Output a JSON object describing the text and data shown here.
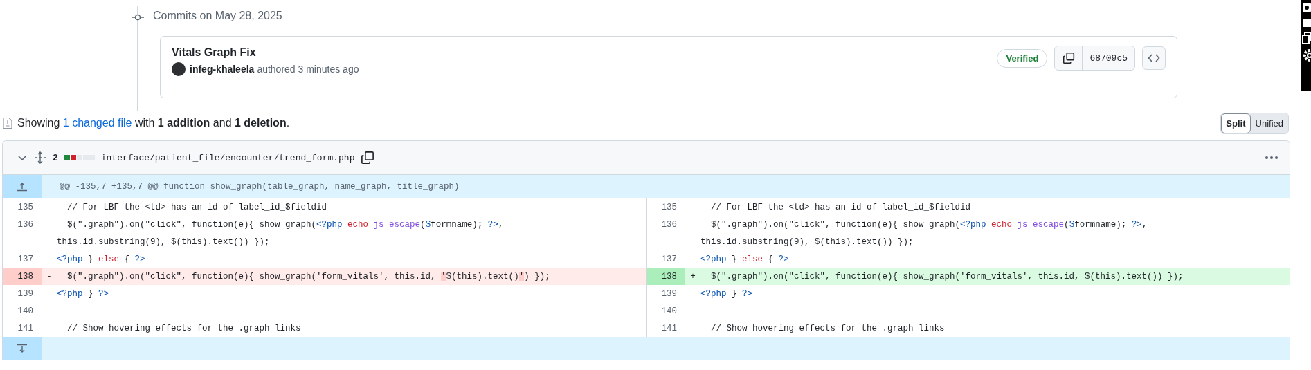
{
  "timeline": {
    "heading": "Commits on May 28, 2025"
  },
  "commit": {
    "title": "Vitals Graph Fix",
    "author": "infeg-khaleela",
    "meta": "authored 3 minutes ago",
    "badge": "Verified",
    "sha": "68709c5"
  },
  "summary": {
    "prefix": "Showing",
    "link": "1 changed file",
    "rest": "with **1 addition** and **1 deletion**."
  },
  "view_toggle": [
    {
      "label": "Split",
      "selected": true
    },
    {
      "label": "Unified",
      "selected": false
    }
  ],
  "file": {
    "count": "2",
    "blocks": [
      {
        "color": "#1f883d"
      },
      {
        "color": "#cf222e"
      },
      {
        "color": "#e6e9ed"
      },
      {
        "color": "#e6e9ed"
      },
      {
        "color": "#e6e9ed"
      }
    ],
    "path": "interface/patient_file/encounter/trend_form.php",
    "hunk_header": "@@ -135,7 +135,7 @@ function show_graph(table_graph, name_graph, title_graph)",
    "left": [
      {
        "num": "135",
        "kind": "context",
        "tokens": [
          {
            "t": "  // For LBF the <td> has an id of label_id_$fieldid",
            "kind": "plain"
          }
        ]
      },
      {
        "num": "136",
        "kind": "context",
        "tokens": [
          {
            "t": "  $(\".graph\").on(\"click\", function(e){ show_graph(",
            "kind": "plain"
          },
          {
            "t": "<?php",
            "kind": "tag"
          },
          {
            "t": " echo",
            "kind": "keyword"
          },
          {
            "t": " js_escape",
            "kind": "func"
          },
          {
            "t": "(",
            "kind": "plain"
          },
          {
            "t": "$",
            "kind": "tag"
          },
          {
            "t": "formname); ",
            "kind": "plain"
          },
          {
            "t": "?>",
            "kind": "tag"
          },
          {
            "t": ",",
            "kind": "plain"
          }
        ],
        "continued": "this.id.substring(9), $(this).text()) });"
      },
      {
        "num": "137",
        "kind": "context",
        "tokens": [
          {
            "t": "<?php",
            "kind": "tag"
          },
          {
            "t": " } ",
            "kind": "plain"
          },
          {
            "t": "else",
            "kind": "keyword"
          },
          {
            "t": " { ",
            "kind": "plain"
          },
          {
            "t": "?>",
            "kind": "tag"
          }
        ]
      },
      {
        "num": "138",
        "kind": "deletion",
        "marker": "-",
        "tokens": [
          {
            "t": "  $(\".graph\").on(\"click\", function(e){ show_graph('form_vitals', this.id, ",
            "kind": "plain"
          },
          {
            "t": "'",
            "kind": "changed"
          },
          {
            "t": "$(this).text()",
            "kind": "plain"
          },
          {
            "t": "'",
            "kind": "changed"
          },
          {
            "t": ") });",
            "kind": "plain"
          }
        ]
      },
      {
        "num": "139",
        "kind": "context",
        "tokens": [
          {
            "t": "<?php",
            "kind": "tag"
          },
          {
            "t": " } ",
            "kind": "plain"
          },
          {
            "t": "?>",
            "kind": "tag"
          }
        ]
      },
      {
        "num": "140",
        "kind": "context"
      },
      {
        "num": "141",
        "kind": "context",
        "tokens": [
          {
            "t": "  // Show hovering effects for the .graph links",
            "kind": "plain"
          }
        ]
      }
    ],
    "right": [
      {
        "num": "135",
        "kind": "context",
        "tokens": [
          {
            "t": "  // For LBF the <td> has an id of label_id_$fieldid",
            "kind": "plain"
          }
        ]
      },
      {
        "num": "136",
        "kind": "context",
        "tokens": [
          {
            "t": "  $(\".graph\").on(\"click\", function(e){ show_graph(",
            "kind": "plain"
          },
          {
            "t": "<?php",
            "kind": "tag"
          },
          {
            "t": " echo",
            "kind": "keyword"
          },
          {
            "t": " js_escape",
            "kind": "func"
          },
          {
            "t": "(",
            "kind": "plain"
          },
          {
            "t": "$",
            "kind": "tag"
          },
          {
            "t": "formname); ",
            "kind": "plain"
          },
          {
            "t": "?>",
            "kind": "tag"
          },
          {
            "t": ",",
            "kind": "plain"
          }
        ],
        "continued": "this.id.substring(9), $(this).text()) });"
      },
      {
        "num": "137",
        "kind": "context",
        "tokens": [
          {
            "t": "<?php",
            "kind": "tag"
          },
          {
            "t": " } ",
            "kind": "plain"
          },
          {
            "t": "else",
            "kind": "keyword"
          },
          {
            "t": " { ",
            "kind": "plain"
          },
          {
            "t": "?>",
            "kind": "tag"
          }
        ]
      },
      {
        "num": "138",
        "kind": "addition",
        "marker": "+",
        "tokens": [
          {
            "t": "  $(\".graph\").on(\"click\", function(e){ show_graph('form_vitals', this.id, $(this).text()) });",
            "kind": "plain"
          }
        ]
      },
      {
        "num": "139",
        "kind": "context",
        "tokens": [
          {
            "t": "<?php",
            "kind": "tag"
          },
          {
            "t": " } ",
            "kind": "plain"
          },
          {
            "t": "?>",
            "kind": "tag"
          }
        ]
      },
      {
        "num": "140",
        "kind": "context"
      },
      {
        "num": "141",
        "kind": "context",
        "tokens": [
          {
            "t": "  // Show hovering effects for the .graph links",
            "kind": "plain"
          }
        ]
      }
    ]
  }
}
